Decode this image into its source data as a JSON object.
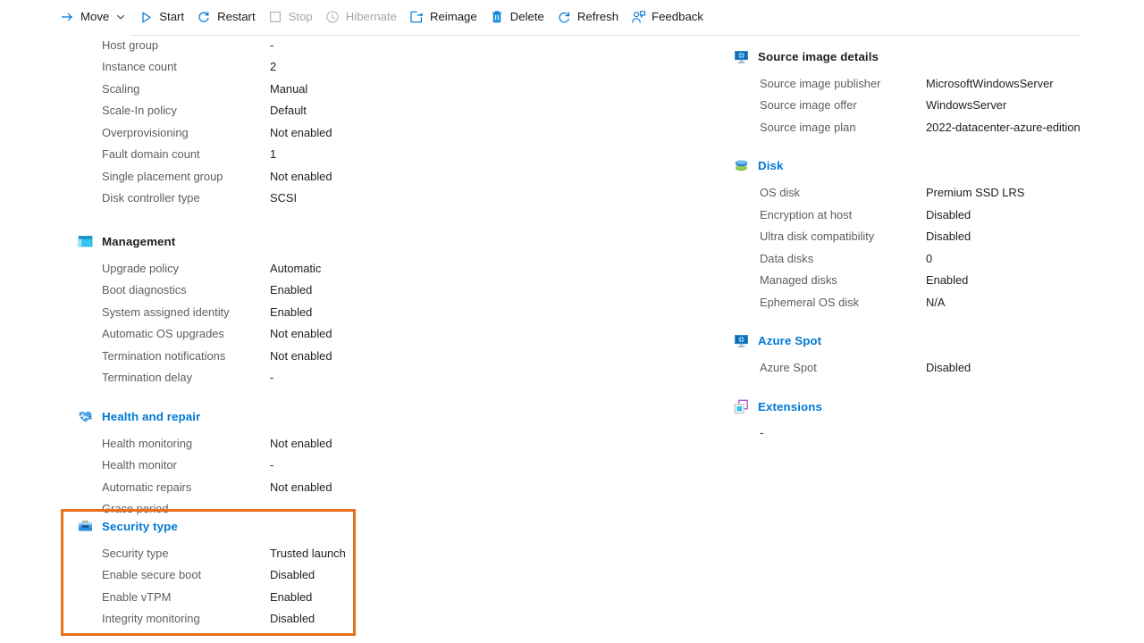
{
  "toolbar": {
    "items": [
      {
        "label": "Move",
        "icon": "arrow-right-icon",
        "disabled": false,
        "caret": true
      },
      {
        "label": "Start",
        "icon": "play-icon",
        "disabled": false,
        "caret": false
      },
      {
        "label": "Restart",
        "icon": "restart-icon",
        "disabled": false,
        "caret": false
      },
      {
        "label": "Stop",
        "icon": "stop-icon",
        "disabled": true,
        "caret": false
      },
      {
        "label": "Hibernate",
        "icon": "clock-icon",
        "disabled": true,
        "caret": false
      },
      {
        "label": "Reimage",
        "icon": "reimage-icon",
        "disabled": false,
        "caret": false
      },
      {
        "label": "Delete",
        "icon": "trash-icon",
        "disabled": false,
        "caret": false
      },
      {
        "label": "Refresh",
        "icon": "refresh-icon",
        "disabled": false,
        "caret": false
      },
      {
        "label": "Feedback",
        "icon": "feedback-icon",
        "disabled": false,
        "caret": false
      }
    ]
  },
  "colors": {
    "accent": "#0078d4",
    "highlight_border": "#e8711a",
    "label": "#605e5c",
    "value": "#201f1e"
  },
  "left_column": {
    "top_rows": [
      {
        "key": "Host group",
        "value": "-"
      },
      {
        "key": "Instance count",
        "value": "2"
      },
      {
        "key": "Scaling",
        "value": "Manual"
      },
      {
        "key": "Scale-In policy",
        "value": "Default"
      },
      {
        "key": "Overprovisioning",
        "value": "Not enabled"
      },
      {
        "key": "Fault domain count",
        "value": "1"
      },
      {
        "key": "Single placement group",
        "value": "Not enabled"
      },
      {
        "key": "Disk controller type",
        "value": "SCSI"
      }
    ],
    "management": {
      "title": "Management",
      "icon": "management-window-icon",
      "rows": [
        {
          "key": "Upgrade policy",
          "value": "Automatic"
        },
        {
          "key": "Boot diagnostics",
          "value": "Enabled"
        },
        {
          "key": "System assigned identity",
          "value": "Enabled"
        },
        {
          "key": "Automatic OS upgrades",
          "value": "Not enabled"
        },
        {
          "key": "Termination notifications",
          "value": "Not enabled"
        },
        {
          "key": "Termination delay",
          "value": "-"
        }
      ]
    },
    "health_and_repair": {
      "title": "Health and repair",
      "icon": "heart-pulse-icon",
      "rows": [
        {
          "key": "Health monitoring",
          "value": "Not enabled"
        },
        {
          "key": "Health monitor",
          "value": "-"
        },
        {
          "key": "Automatic repairs",
          "value": "Not enabled"
        },
        {
          "key": "Grace period",
          "value": "-"
        }
      ]
    },
    "security_type": {
      "title": "Security type",
      "icon": "toolbox-icon",
      "highlighted": true,
      "rows": [
        {
          "key": "Security type",
          "value": "Trusted launch"
        },
        {
          "key": "Enable secure boot",
          "value": "Disabled"
        },
        {
          "key": "Enable vTPM",
          "value": "Enabled"
        },
        {
          "key": "Integrity monitoring",
          "value": "Disabled"
        }
      ]
    }
  },
  "right_column": {
    "source_image_details": {
      "title": "Source image details",
      "icon": "monitor-icon",
      "rows": [
        {
          "key": "Source image publisher",
          "value": "MicrosoftWindowsServer"
        },
        {
          "key": "Source image offer",
          "value": "WindowsServer"
        },
        {
          "key": "Source image plan",
          "value": "2022-datacenter-azure-edition"
        }
      ]
    },
    "disk": {
      "title": "Disk",
      "icon": "disk-stack-icon",
      "rows": [
        {
          "key": "OS disk",
          "value": "Premium SSD LRS"
        },
        {
          "key": "Encryption at host",
          "value": "Disabled"
        },
        {
          "key": "Ultra disk compatibility",
          "value": "Disabled"
        },
        {
          "key": "Data disks",
          "value": "0"
        },
        {
          "key": "Managed disks",
          "value": "Enabled"
        },
        {
          "key": "Ephemeral OS disk",
          "value": "N/A"
        }
      ]
    },
    "azure_spot": {
      "title": "Azure Spot",
      "icon": "monitor-icon",
      "rows": [
        {
          "key": "Azure Spot",
          "value": "Disabled"
        }
      ]
    },
    "extensions": {
      "title": "Extensions",
      "icon": "extensions-icon",
      "empty_value": "-"
    }
  }
}
